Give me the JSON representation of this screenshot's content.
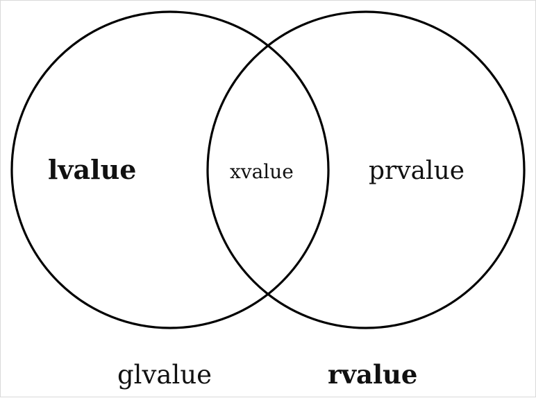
{
  "diagram": {
    "labels": {
      "lvalue": "lvalue",
      "xvalue": "xvalue",
      "prvalue": "prvalue",
      "glvalue": "glvalue",
      "rvalue": "rvalue"
    },
    "colors": {
      "stroke": "#000000",
      "text": "#111111",
      "background": "#ffffff"
    }
  }
}
